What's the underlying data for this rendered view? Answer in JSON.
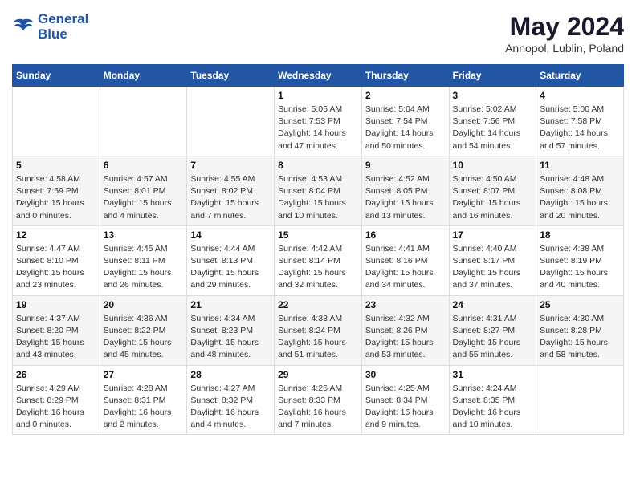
{
  "header": {
    "logo_line1": "General",
    "logo_line2": "Blue",
    "month_title": "May 2024",
    "location": "Annopol, Lublin, Poland"
  },
  "days_of_week": [
    "Sunday",
    "Monday",
    "Tuesday",
    "Wednesday",
    "Thursday",
    "Friday",
    "Saturday"
  ],
  "weeks": [
    [
      {
        "day": "",
        "info": ""
      },
      {
        "day": "",
        "info": ""
      },
      {
        "day": "",
        "info": ""
      },
      {
        "day": "1",
        "info": "Sunrise: 5:05 AM\nSunset: 7:53 PM\nDaylight: 14 hours\nand 47 minutes."
      },
      {
        "day": "2",
        "info": "Sunrise: 5:04 AM\nSunset: 7:54 PM\nDaylight: 14 hours\nand 50 minutes."
      },
      {
        "day": "3",
        "info": "Sunrise: 5:02 AM\nSunset: 7:56 PM\nDaylight: 14 hours\nand 54 minutes."
      },
      {
        "day": "4",
        "info": "Sunrise: 5:00 AM\nSunset: 7:58 PM\nDaylight: 14 hours\nand 57 minutes."
      }
    ],
    [
      {
        "day": "5",
        "info": "Sunrise: 4:58 AM\nSunset: 7:59 PM\nDaylight: 15 hours\nand 0 minutes."
      },
      {
        "day": "6",
        "info": "Sunrise: 4:57 AM\nSunset: 8:01 PM\nDaylight: 15 hours\nand 4 minutes."
      },
      {
        "day": "7",
        "info": "Sunrise: 4:55 AM\nSunset: 8:02 PM\nDaylight: 15 hours\nand 7 minutes."
      },
      {
        "day": "8",
        "info": "Sunrise: 4:53 AM\nSunset: 8:04 PM\nDaylight: 15 hours\nand 10 minutes."
      },
      {
        "day": "9",
        "info": "Sunrise: 4:52 AM\nSunset: 8:05 PM\nDaylight: 15 hours\nand 13 minutes."
      },
      {
        "day": "10",
        "info": "Sunrise: 4:50 AM\nSunset: 8:07 PM\nDaylight: 15 hours\nand 16 minutes."
      },
      {
        "day": "11",
        "info": "Sunrise: 4:48 AM\nSunset: 8:08 PM\nDaylight: 15 hours\nand 20 minutes."
      }
    ],
    [
      {
        "day": "12",
        "info": "Sunrise: 4:47 AM\nSunset: 8:10 PM\nDaylight: 15 hours\nand 23 minutes."
      },
      {
        "day": "13",
        "info": "Sunrise: 4:45 AM\nSunset: 8:11 PM\nDaylight: 15 hours\nand 26 minutes."
      },
      {
        "day": "14",
        "info": "Sunrise: 4:44 AM\nSunset: 8:13 PM\nDaylight: 15 hours\nand 29 minutes."
      },
      {
        "day": "15",
        "info": "Sunrise: 4:42 AM\nSunset: 8:14 PM\nDaylight: 15 hours\nand 32 minutes."
      },
      {
        "day": "16",
        "info": "Sunrise: 4:41 AM\nSunset: 8:16 PM\nDaylight: 15 hours\nand 34 minutes."
      },
      {
        "day": "17",
        "info": "Sunrise: 4:40 AM\nSunset: 8:17 PM\nDaylight: 15 hours\nand 37 minutes."
      },
      {
        "day": "18",
        "info": "Sunrise: 4:38 AM\nSunset: 8:19 PM\nDaylight: 15 hours\nand 40 minutes."
      }
    ],
    [
      {
        "day": "19",
        "info": "Sunrise: 4:37 AM\nSunset: 8:20 PM\nDaylight: 15 hours\nand 43 minutes."
      },
      {
        "day": "20",
        "info": "Sunrise: 4:36 AM\nSunset: 8:22 PM\nDaylight: 15 hours\nand 45 minutes."
      },
      {
        "day": "21",
        "info": "Sunrise: 4:34 AM\nSunset: 8:23 PM\nDaylight: 15 hours\nand 48 minutes."
      },
      {
        "day": "22",
        "info": "Sunrise: 4:33 AM\nSunset: 8:24 PM\nDaylight: 15 hours\nand 51 minutes."
      },
      {
        "day": "23",
        "info": "Sunrise: 4:32 AM\nSunset: 8:26 PM\nDaylight: 15 hours\nand 53 minutes."
      },
      {
        "day": "24",
        "info": "Sunrise: 4:31 AM\nSunset: 8:27 PM\nDaylight: 15 hours\nand 55 minutes."
      },
      {
        "day": "25",
        "info": "Sunrise: 4:30 AM\nSunset: 8:28 PM\nDaylight: 15 hours\nand 58 minutes."
      }
    ],
    [
      {
        "day": "26",
        "info": "Sunrise: 4:29 AM\nSunset: 8:29 PM\nDaylight: 16 hours\nand 0 minutes."
      },
      {
        "day": "27",
        "info": "Sunrise: 4:28 AM\nSunset: 8:31 PM\nDaylight: 16 hours\nand 2 minutes."
      },
      {
        "day": "28",
        "info": "Sunrise: 4:27 AM\nSunset: 8:32 PM\nDaylight: 16 hours\nand 4 minutes."
      },
      {
        "day": "29",
        "info": "Sunrise: 4:26 AM\nSunset: 8:33 PM\nDaylight: 16 hours\nand 7 minutes."
      },
      {
        "day": "30",
        "info": "Sunrise: 4:25 AM\nSunset: 8:34 PM\nDaylight: 16 hours\nand 9 minutes."
      },
      {
        "day": "31",
        "info": "Sunrise: 4:24 AM\nSunset: 8:35 PM\nDaylight: 16 hours\nand 10 minutes."
      },
      {
        "day": "",
        "info": ""
      }
    ]
  ]
}
